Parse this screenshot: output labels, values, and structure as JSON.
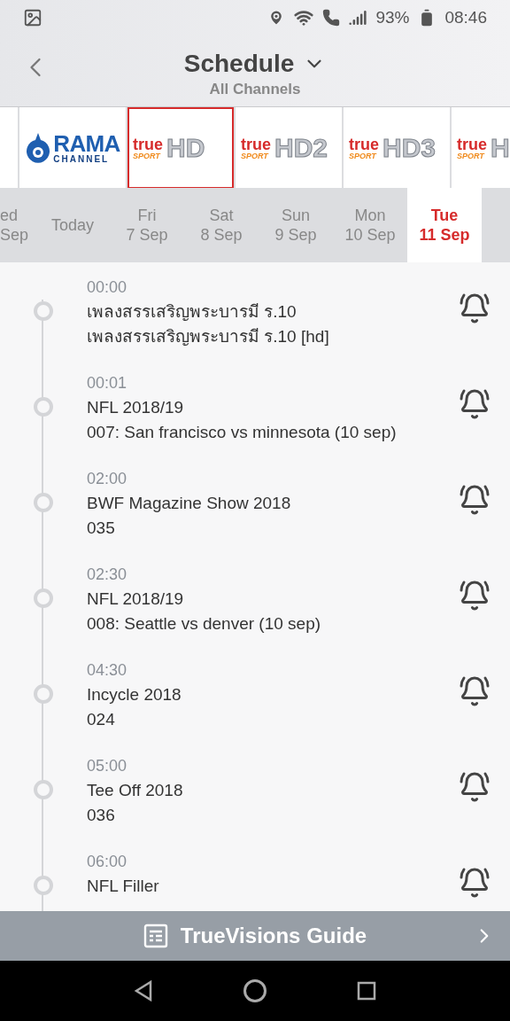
{
  "status_bar": {
    "battery": "93%",
    "time": "08:46"
  },
  "header": {
    "title": "Schedule",
    "subtitle": "All Channels"
  },
  "channels": [
    {
      "kind": "rama",
      "name": "RAMA",
      "tagline": "CHANNEL",
      "selected": false
    },
    {
      "kind": "true",
      "brand": "true",
      "tagline": "SPORT",
      "mark": "HD",
      "selected": true
    },
    {
      "kind": "true",
      "brand": "true",
      "tagline": "SPORT",
      "mark": "HD2",
      "selected": false
    },
    {
      "kind": "true",
      "brand": "true",
      "tagline": "SPORT",
      "mark": "HD3",
      "selected": false
    },
    {
      "kind": "true",
      "brand": "true",
      "tagline": "SPORT",
      "mark": "H",
      "selected": false
    }
  ],
  "days": [
    {
      "day": "ed",
      "date": "Sep",
      "selected": false
    },
    {
      "day": "Today",
      "selected": false
    },
    {
      "day": "Fri",
      "date": "7 Sep",
      "selected": false
    },
    {
      "day": "Sat",
      "date": "8 Sep",
      "selected": false
    },
    {
      "day": "Sun",
      "date": "9 Sep",
      "selected": false
    },
    {
      "day": "Mon",
      "date": "10 Sep",
      "selected": false
    },
    {
      "day": "Tue",
      "date": "11 Sep",
      "selected": true
    }
  ],
  "programs": [
    {
      "time": "00:00",
      "title": "เพลงสรรเสริญพระบารมี ร.10",
      "episode": "เพลงสรรเสริญพระบารมี ร.10 [hd]"
    },
    {
      "time": "00:01",
      "title": "NFL 2018/19",
      "episode": "007: San francisco vs minnesota (10 sep)"
    },
    {
      "time": "02:00",
      "title": "BWF Magazine Show 2018",
      "episode": "035"
    },
    {
      "time": "02:30",
      "title": "NFL 2018/19",
      "episode": "008: Seattle vs denver (10 sep)"
    },
    {
      "time": "04:30",
      "title": "Incycle 2018",
      "episode": "024"
    },
    {
      "time": "05:00",
      "title": "Tee Off 2018",
      "episode": "036"
    },
    {
      "time": "06:00",
      "title": "NFL Filler"
    }
  ],
  "footer": {
    "label": "TrueVisions Guide"
  }
}
